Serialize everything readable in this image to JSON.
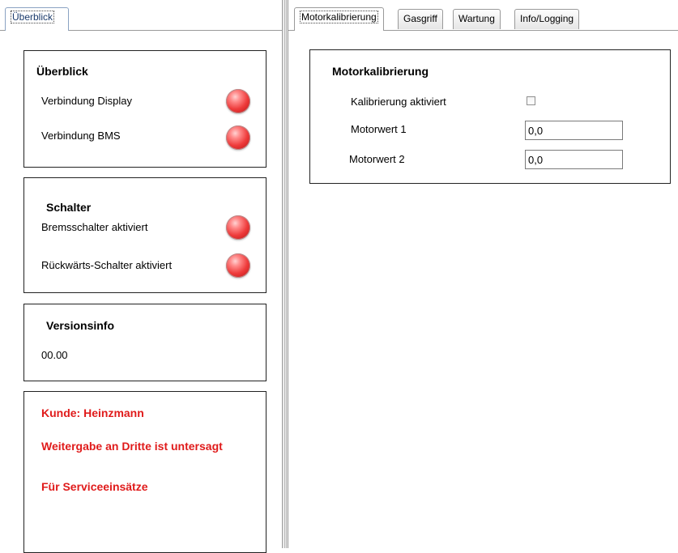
{
  "left_tabs": [
    {
      "label": "Überblick"
    }
  ],
  "overview": {
    "title": "Überblick",
    "items": [
      {
        "label": "Verbindung Display",
        "state": "off"
      },
      {
        "label": "Verbindung BMS",
        "state": "off"
      }
    ]
  },
  "switches": {
    "title": "Schalter",
    "items": [
      {
        "label": "Bremsschalter aktiviert",
        "state": "off"
      },
      {
        "label": "Rückwärts-Schalter aktiviert",
        "state": "off"
      }
    ]
  },
  "version": {
    "title": "Versionsinfo",
    "value": "00.00"
  },
  "notice": {
    "lines": [
      "Kunde: Heinzmann",
      "Weitergabe an Dritte ist untersagt",
      "Für Serviceeinsätze"
    ],
    "color": "#e01b1b"
  },
  "right_tabs": [
    {
      "label": "Motorkalibrierung",
      "active": true
    },
    {
      "label": "Gasgriff",
      "active": false
    },
    {
      "label": "Wartung",
      "active": false
    },
    {
      "label": "Info/Logging",
      "active": false
    }
  ],
  "motor_calibration": {
    "title": "Motorkalibrierung",
    "checkbox_label": "Kalibrierung aktiviert",
    "checkbox_checked": false,
    "fields": [
      {
        "label": "Motorwert 1",
        "value": "0,0"
      },
      {
        "label": "Motorwert 2",
        "value": "0,0"
      }
    ]
  },
  "colors": {
    "led_off": "#ee3b3b",
    "notice_text": "#e01b1b"
  },
  "icons": [
    "status-led-icon"
  ]
}
